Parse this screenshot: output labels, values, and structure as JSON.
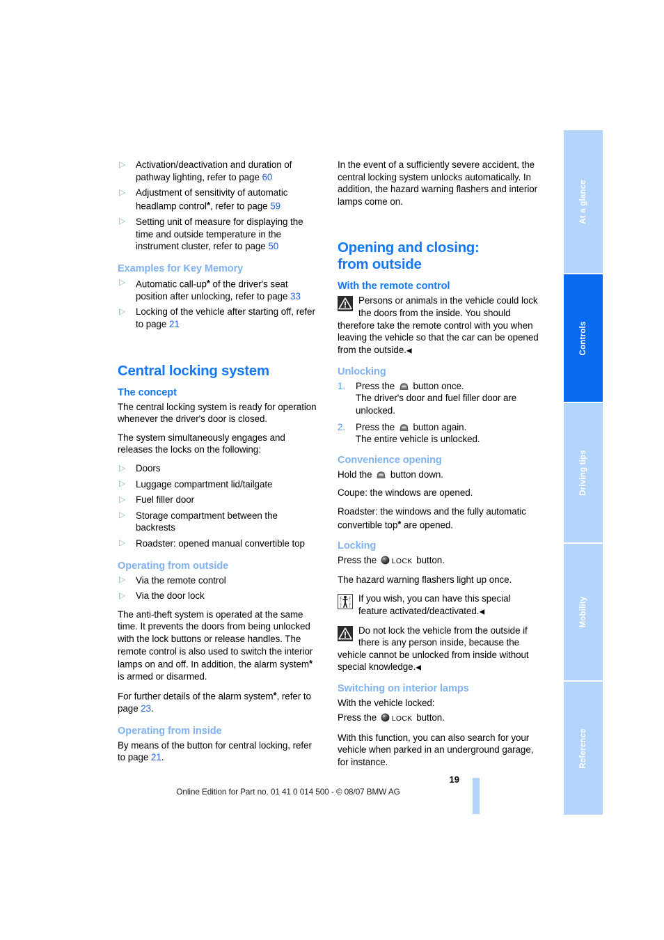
{
  "page": {
    "number": "19",
    "footer": "Online Edition for Part no. 01 41 0 014 500 - © 08/07 BMW AG"
  },
  "colors": {
    "heading_blue": "#1478F0",
    "subheading_blue": "#7FB2EE",
    "page_ref_blue": "#1F5FE0",
    "tab_inactive": "#B3D4FB",
    "tab_active": "#0A6AF0"
  },
  "tabs": [
    {
      "label": "At a glance",
      "active": false
    },
    {
      "label": "Controls",
      "active": true
    },
    {
      "label": "Driving tips",
      "active": false
    },
    {
      "label": "Mobility",
      "active": false
    },
    {
      "label": "Reference",
      "active": false
    }
  ],
  "left_column": {
    "intro_bullets": [
      {
        "text_before": "Activation/deactivation and duration of pathway lighting, refer to page ",
        "page_ref": "60",
        "text_after": ""
      },
      {
        "text_before": "Adjustment of sensitivity of automatic headlamp control",
        "option_marker": "*",
        "text_mid": ", refer to page ",
        "page_ref": "59",
        "text_after": ""
      },
      {
        "text_before": "Setting unit of measure for displaying the time and outside temperature in the instrument cluster, refer to page ",
        "page_ref": "50",
        "text_after": ""
      }
    ],
    "key_memory": {
      "heading": "Examples for Key Memory",
      "bullets": [
        {
          "text_before": "Automatic call-up",
          "option_marker": "*",
          "text_mid": " of the driver's seat position after unlocking, refer to page ",
          "page_ref": "33",
          "text_after": ""
        },
        {
          "text_before": "Locking of the vehicle after starting off, refer to page ",
          "page_ref": "21",
          "text_after": ""
        }
      ]
    },
    "central_locking": {
      "title": "Central locking system",
      "concept": {
        "heading": "The concept",
        "para1": "The central locking system is ready for operation whenever the driver's door is closed.",
        "para2": "The system simultaneously engages and releases the locks on the following:",
        "items": [
          "Doors",
          "Luggage compartment lid/tailgate",
          "Fuel filler door",
          "Storage compartment between the backrests",
          "Roadster: opened manual convertible top"
        ]
      },
      "operating_outside": {
        "heading": "Operating from outside",
        "items": [
          "Via the remote control",
          "Via the door lock"
        ],
        "para1_before": "The anti-theft system is operated at the same time. It prevents the doors from being unlocked with the lock buttons or release handles. The remote control is also used to switch the interior lamps on and off. In addition, the alarm system",
        "para1_option": "*",
        "para1_after": " is armed or disarmed.",
        "para2_before": "For further details of the alarm system",
        "para2_option": "*",
        "para2_mid": ", refer to page ",
        "para2_ref": "23",
        "para2_after": "."
      },
      "operating_inside": {
        "heading": "Operating from inside",
        "para_before": "By means of the button for central locking, refer to page ",
        "para_ref": "21",
        "para_after": "."
      }
    }
  },
  "right_column": {
    "intro_para": "In the event of a sufficiently severe accident, the central locking system unlocks automatically. In addition, the hazard warning flashers and interior lamps come on.",
    "opening_closing": {
      "title_line1": "Opening and closing:",
      "title_line2": "from outside",
      "remote_control": {
        "heading": "With the remote control",
        "warning_icon": "warning-triangle-icon",
        "warning_text": "Persons or animals in the vehicle could lock the doors from the inside. You should therefore take the remote control with you when leaving the vehicle so that the car can be opened from the outside.",
        "end_marker": "◀"
      },
      "unlocking": {
        "heading": "Unlocking",
        "steps": [
          {
            "before": "Press the ",
            "icon": "unlock-button-icon",
            "after": " button once.",
            "sub": "The driver's door and fuel filler door are unlocked."
          },
          {
            "before": "Press the ",
            "icon": "unlock-button-icon",
            "after": " button again.",
            "sub": "The entire vehicle is unlocked."
          }
        ]
      },
      "convenience_opening": {
        "heading": "Convenience opening",
        "line1_before": "Hold the ",
        "line1_icon": "unlock-button-icon",
        "line1_after": " button down.",
        "line2": "Coupe: the windows are opened.",
        "line3_before": "Roadster: the windows and the fully automatic convertible top",
        "line3_option": "*",
        "line3_after": " are opened."
      },
      "locking": {
        "heading": "Locking",
        "line1_before": "Press the ",
        "line1_icon": "lock-button-icon",
        "line1_lock_word": "LOCK",
        "line1_after": " button.",
        "line2": "The hazard warning flashers light up once.",
        "note1_icon": "person-special-feature-icon",
        "note1_text": "If you wish, you can have this special feature activated/deactivated.",
        "note1_end": "◀",
        "note2_icon": "warning-triangle-icon",
        "note2_text": "Do not lock the vehicle from the outside if there is any person inside, because the vehicle cannot be unlocked from inside without special knowledge.",
        "note2_end": "◀"
      },
      "interior_lamps": {
        "heading": "Switching on interior lamps",
        "line1": "With the vehicle locked:",
        "line2_before": "Press the ",
        "line2_icon": "lock-button-icon",
        "line2_lock_word": "LOCK",
        "line2_after": " button.",
        "line3": "With this function, you can also search for your vehicle when parked in an underground garage, for instance."
      }
    }
  }
}
